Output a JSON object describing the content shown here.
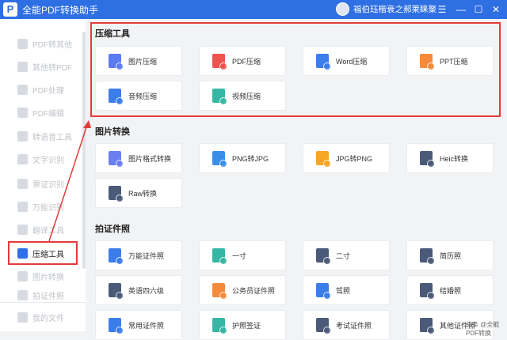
{
  "app": {
    "title": "全能PDF转换助手",
    "logo": "P",
    "user": "福伯珏楷衰之郝莱睐聚"
  },
  "sidebar": {
    "items": [
      {
        "label": "PDF转其他"
      },
      {
        "label": "其他转PDF"
      },
      {
        "label": "PDF处理"
      },
      {
        "label": "PDF编辑"
      },
      {
        "label": "转语音工具"
      },
      {
        "label": "文字识别"
      },
      {
        "label": "票证识别"
      },
      {
        "label": "万能识别"
      },
      {
        "label": "翻译工具"
      },
      {
        "label": "压缩工具"
      },
      {
        "label": "图片转换"
      },
      {
        "label": "拍证件照"
      },
      {
        "label": "我的文件"
      }
    ],
    "active_index": 9
  },
  "sections": [
    {
      "title": "压缩工具",
      "cards": [
        {
          "label": "图片压缩",
          "icon": "image-compress-icon",
          "color": "#5b7bf0"
        },
        {
          "label": "PDF压缩",
          "icon": "pdf-compress-icon",
          "color": "#ef5350"
        },
        {
          "label": "Word压缩",
          "icon": "word-compress-icon",
          "color": "#3b7de9"
        },
        {
          "label": "PPT压缩",
          "icon": "ppt-compress-icon",
          "color": "#f58a3a"
        },
        {
          "label": "音频压缩",
          "icon": "audio-compress-icon",
          "color": "#3b7de9"
        },
        {
          "label": "视频压缩",
          "icon": "video-compress-icon",
          "color": "#36b6a4"
        }
      ]
    },
    {
      "title": "图片转换",
      "cards": [
        {
          "label": "图片格式转换",
          "icon": "image-format-icon",
          "color": "#6a7ff0"
        },
        {
          "label": "PNG转JPG",
          "icon": "png-icon",
          "color": "#3b8fe9"
        },
        {
          "label": "JPG转PNG",
          "icon": "jpg-icon",
          "color": "#f5a623"
        },
        {
          "label": "Heic转换",
          "icon": "heic-icon",
          "color": "#4a5a78"
        },
        {
          "label": "Raw转换",
          "icon": "raw-icon",
          "color": "#4a5a78"
        }
      ]
    },
    {
      "title": "拍证件照",
      "cards": [
        {
          "label": "万能证件照",
          "icon": "id-photo-icon",
          "color": "#3b7de9"
        },
        {
          "label": "一寸",
          "icon": "one-inch-icon",
          "color": "#36b6a4"
        },
        {
          "label": "二寸",
          "icon": "two-inch-icon",
          "color": "#4a5a78"
        },
        {
          "label": "简历照",
          "icon": "resume-photo-icon",
          "color": "#4a5a78"
        },
        {
          "label": "英语四六级",
          "icon": "cet-icon",
          "color": "#4a5a78"
        },
        {
          "label": "公务员证件照",
          "icon": "civil-servant-icon",
          "color": "#f58a3a"
        },
        {
          "label": "驾照",
          "icon": "driver-license-icon",
          "color": "#3b7de9"
        },
        {
          "label": "结婚照",
          "icon": "wedding-photo-icon",
          "color": "#4a5a78"
        },
        {
          "label": "常用证件照",
          "icon": "common-id-icon",
          "color": "#3b7de9"
        },
        {
          "label": "护照签证",
          "icon": "passport-icon",
          "color": "#36b6a4"
        },
        {
          "label": "考试证件照",
          "icon": "exam-photo-icon",
          "color": "#4a5a78"
        },
        {
          "label": "其他证件照",
          "icon": "other-id-icon",
          "color": "#4a5a78"
        }
      ]
    }
  ],
  "colors": {
    "accent": "#2f6fe4",
    "highlight": "#e53b3b"
  },
  "watermark": "头条 @全能PDF转换"
}
